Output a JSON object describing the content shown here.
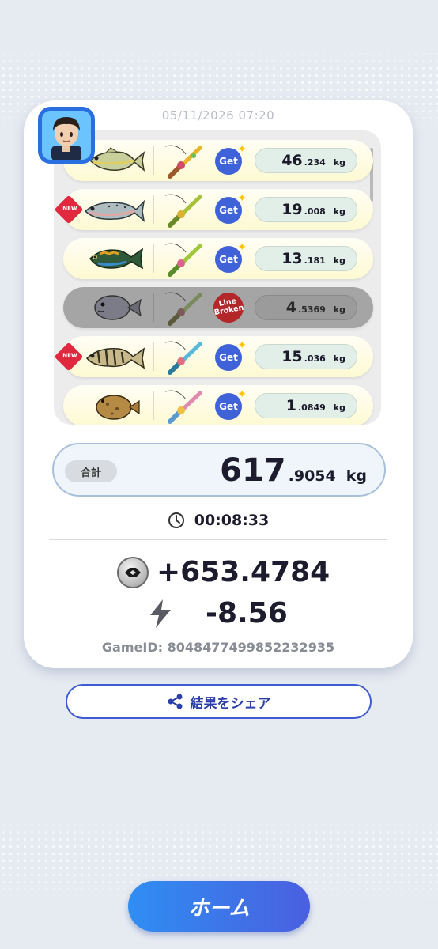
{
  "timestamp": "05/11/2026 07:20",
  "catches": [
    {
      "fish": "yellowtail-fish",
      "new": false,
      "status": "Get",
      "weight_int": "46",
      "weight_dec": ".234",
      "unit": "kg"
    },
    {
      "fish": "salmon-fish",
      "new": true,
      "new_label": "NEW",
      "status": "Get",
      "weight_int": "19",
      "weight_dec": ".008",
      "unit": "kg"
    },
    {
      "fish": "stickleback-fish",
      "new": false,
      "status": "Get",
      "weight_int": "13",
      "weight_dec": ".181",
      "unit": "kg"
    },
    {
      "fish": "puffer-fish",
      "new": false,
      "status": "Line Broken",
      "status_line1": "Line",
      "status_line2": "Broken",
      "weight_int": "4",
      "weight_dec": ".5369",
      "unit": "kg"
    },
    {
      "fish": "perch-fish",
      "new": true,
      "new_label": "NEW",
      "status": "Get",
      "weight_int": "15",
      "weight_dec": ".036",
      "unit": "kg"
    },
    {
      "fish": "flounder-fish",
      "new": false,
      "status": "Get",
      "weight_int": "1",
      "weight_dec": ".0849",
      "unit": "kg"
    }
  ],
  "total": {
    "label": "合計",
    "int": "617",
    "dec": ".9054",
    "unit": "kg"
  },
  "timer": "00:08:33",
  "coins": "+653.4784",
  "energy": "-8.56",
  "game_id": "GameID: 8048477499852232935",
  "share_label": "結果をシェア",
  "home_label": "ホーム",
  "colors": {
    "primary": "#3f5bd4",
    "new_badge": "#e0283e",
    "line_broken": "#b3262a",
    "get": "#3f62d8"
  }
}
